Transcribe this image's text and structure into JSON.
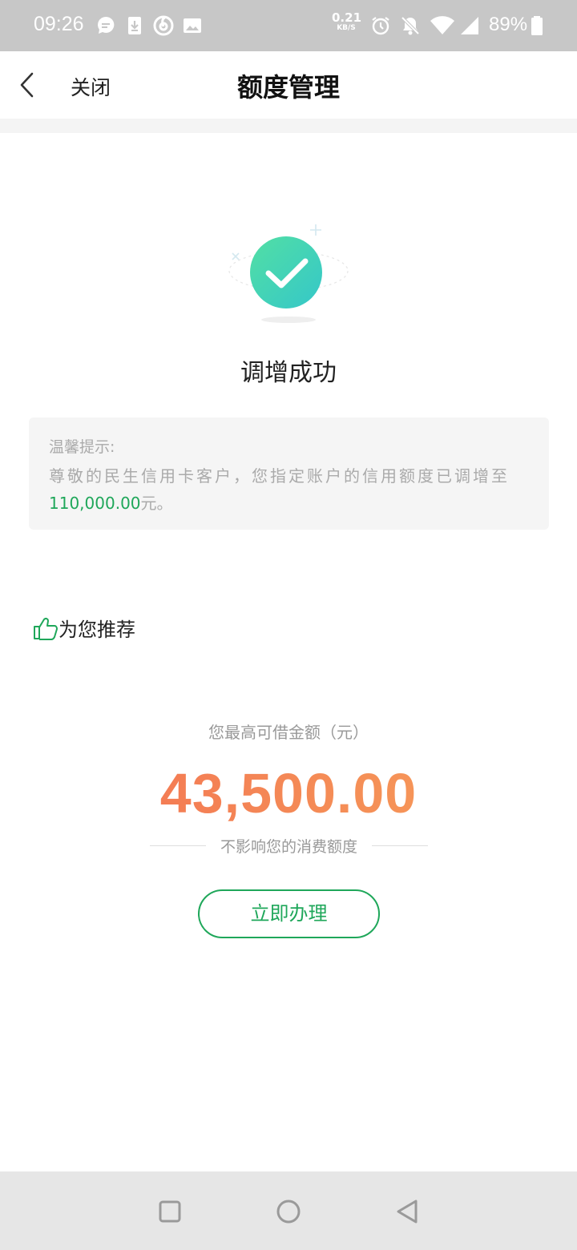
{
  "status_bar": {
    "time": "09:26",
    "net_speed_value": "0.21",
    "net_speed_unit": "KB/S",
    "battery": "89%",
    "icons": [
      "chat-icon",
      "download-icon",
      "music-app-icon",
      "image-icon",
      "alarm-icon",
      "mute-icon",
      "wifi-icon",
      "signal-icon",
      "battery-icon"
    ]
  },
  "nav": {
    "close_label": "关闭",
    "title": "额度管理"
  },
  "result": {
    "status_text": "调增成功"
  },
  "tip": {
    "title": "温馨提示:",
    "body_prefix": "尊敬的民生信用卡客户，您指定账户的信用额度已调增至",
    "amount": "110,000.00",
    "body_suffix": "元。"
  },
  "recommend": {
    "header": "为您推荐",
    "caption": "您最高可借金额（元）",
    "amount": "43,500.00",
    "note": "不影响您的消费额度",
    "button_label": "立即办理"
  },
  "colors": {
    "accent_green": "#1fa75a",
    "check_teal": "#3fd1b5",
    "amount_orange": "#f26e52"
  }
}
